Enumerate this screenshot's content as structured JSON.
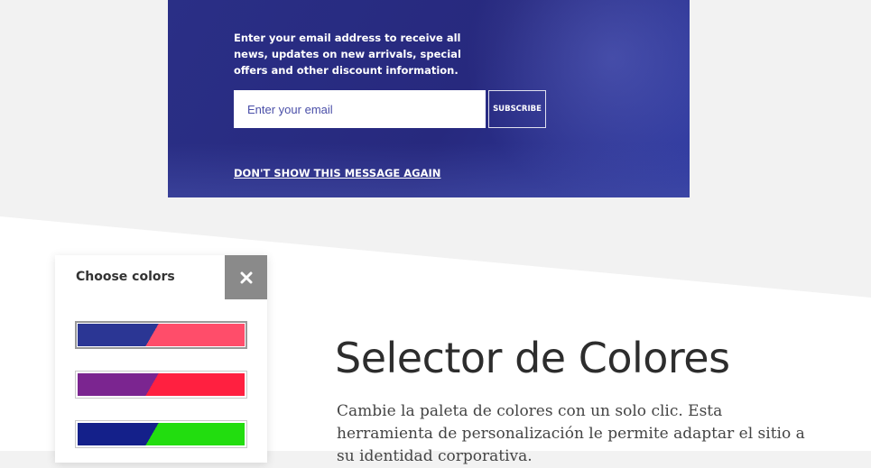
{
  "newsletter": {
    "text": "Enter your email address to receive all news, updates on new arrivals, special offers and other discount information.",
    "email_placeholder": "Enter your email",
    "subscribe_label": "SUBSCRIBE",
    "dont_show_label": "DON'T SHOW THIS MESSAGE AGAIN",
    "background_color": "#2a2f86"
  },
  "color_panel": {
    "title": "Choose colors",
    "close_icon": "close-icon",
    "swatches": [
      {
        "name": "palette-1",
        "primary": "#2b3694",
        "secondary": "#ff4d6a",
        "selected": true
      },
      {
        "name": "palette-2",
        "primary": "#7b2590",
        "secondary": "#ff2040",
        "selected": false
      },
      {
        "name": "palette-3",
        "primary": "#14208a",
        "secondary": "#22dd0f",
        "selected": false
      }
    ]
  },
  "feature": {
    "title": "Selector de Colores",
    "description": "Cambie la paleta de colores con un solo clic. Esta herramienta de personalización le permite adaptar el sitio a su identidad corporativa."
  }
}
